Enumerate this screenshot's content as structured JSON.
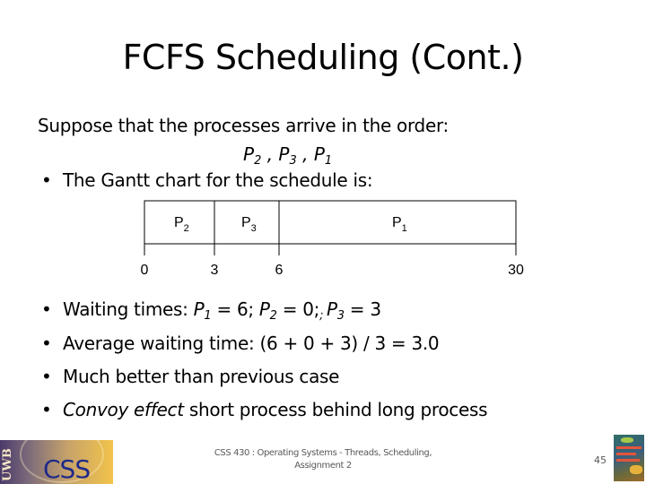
{
  "slide": {
    "title": "FCFS Scheduling (Cont.)",
    "intro": "Suppose that the processes arrive in the order:",
    "order": [
      {
        "base": "P",
        "sub": "2"
      },
      {
        "base": "P",
        "sub": "3"
      },
      {
        "base": "P",
        "sub": "1"
      }
    ],
    "order_sep": " , ",
    "gantt_bullet": "The Gantt chart for the schedule is:",
    "bullets": {
      "waiting_label": "Waiting times: ",
      "waiting": [
        {
          "base": "P",
          "sub": "1",
          "rest": " = 6; "
        },
        {
          "base": "P",
          "sub": "2",
          "rest": " = 0;"
        },
        {
          "stray": "; "
        },
        {
          "base": "P",
          "sub": "3",
          "rest": " = 3"
        }
      ],
      "average": "Average waiting time:  (6 + 0 + 3) / 3 = 3.0",
      "better": "Much better than previous case",
      "convoy_italic": "Convoy effect",
      "convoy_rest": " short process behind long process"
    },
    "bullet_glyph": "•"
  },
  "chart_data": {
    "type": "gantt",
    "title": "",
    "xlim": [
      0,
      30
    ],
    "segments": [
      {
        "label": "P",
        "sub": "2",
        "start": 0,
        "end": 3
      },
      {
        "label": "P",
        "sub": "3",
        "start": 3,
        "end": 6
      },
      {
        "label": "P",
        "sub": "1",
        "start": 6,
        "end": 30
      }
    ],
    "tick_labels": [
      "0",
      "3",
      "6",
      "30"
    ],
    "ticks": [
      0,
      3,
      6,
      30
    ]
  },
  "footer": {
    "course_line1": "CSS 430 : Operating Systems - Threads, Scheduling,",
    "course_line2": "Assignment 2",
    "page_number": "45",
    "logo_left_text": "UWB",
    "logo_main_text": "CSS"
  },
  "colors": {
    "footer_text": "#595959",
    "logo_blue": "#1f2a8a",
    "logo_gold": "#f2c34a"
  }
}
